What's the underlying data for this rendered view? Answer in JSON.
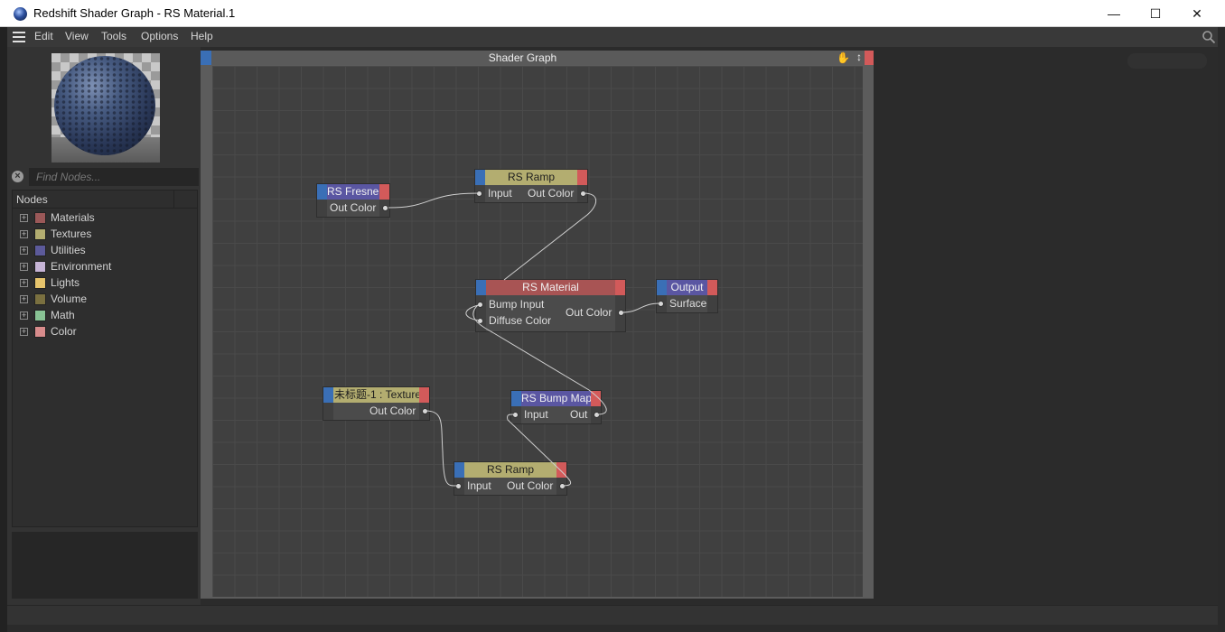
{
  "window": {
    "title": "Redshift Shader Graph - RS Material.1",
    "minimize": "—",
    "maximize": "☐",
    "close": "✕"
  },
  "menu": {
    "items": [
      "Edit",
      "View",
      "Tools",
      "Options",
      "Help"
    ]
  },
  "search": {
    "placeholder": "Find Nodes..."
  },
  "tree": {
    "header": "Nodes",
    "items": [
      {
        "label": "Materials",
        "color": "#9a5858"
      },
      {
        "label": "Textures",
        "color": "#b3ad70"
      },
      {
        "label": "Utilities",
        "color": "#5c5a9a"
      },
      {
        "label": "Environment",
        "color": "#c6b4d6"
      },
      {
        "label": "Lights",
        "color": "#e6c46c"
      },
      {
        "label": "Volume",
        "color": "#7a7040"
      },
      {
        "label": "Math",
        "color": "#88c294"
      },
      {
        "label": "Color",
        "color": "#d88c8c"
      }
    ]
  },
  "graph": {
    "title": "Shader Graph"
  },
  "nodes": {
    "fresnel": {
      "title": "RS Fresnel",
      "color": "#5a56a2",
      "out": "Out Color"
    },
    "ramp1": {
      "title": "RS Ramp",
      "color": "#b3ad70",
      "in": "Input",
      "out": "Out Color"
    },
    "material": {
      "title": "RS Material",
      "color": "#a85454",
      "in1": "Bump Input",
      "in2": "Diffuse Color",
      "out": "Out Color"
    },
    "output": {
      "title": "Output",
      "color": "#5a56a2",
      "in": "Surface"
    },
    "texture": {
      "title": "未标题-1 : Texture",
      "color": "#b3ad70",
      "out": "Out Color"
    },
    "bump": {
      "title": "RS Bump Map",
      "color": "#5a56a2",
      "in": "Input",
      "out": "Out"
    },
    "ramp2": {
      "title": "RS Ramp",
      "color": "#b3ad70",
      "in": "Input",
      "out": "Out Color"
    }
  }
}
